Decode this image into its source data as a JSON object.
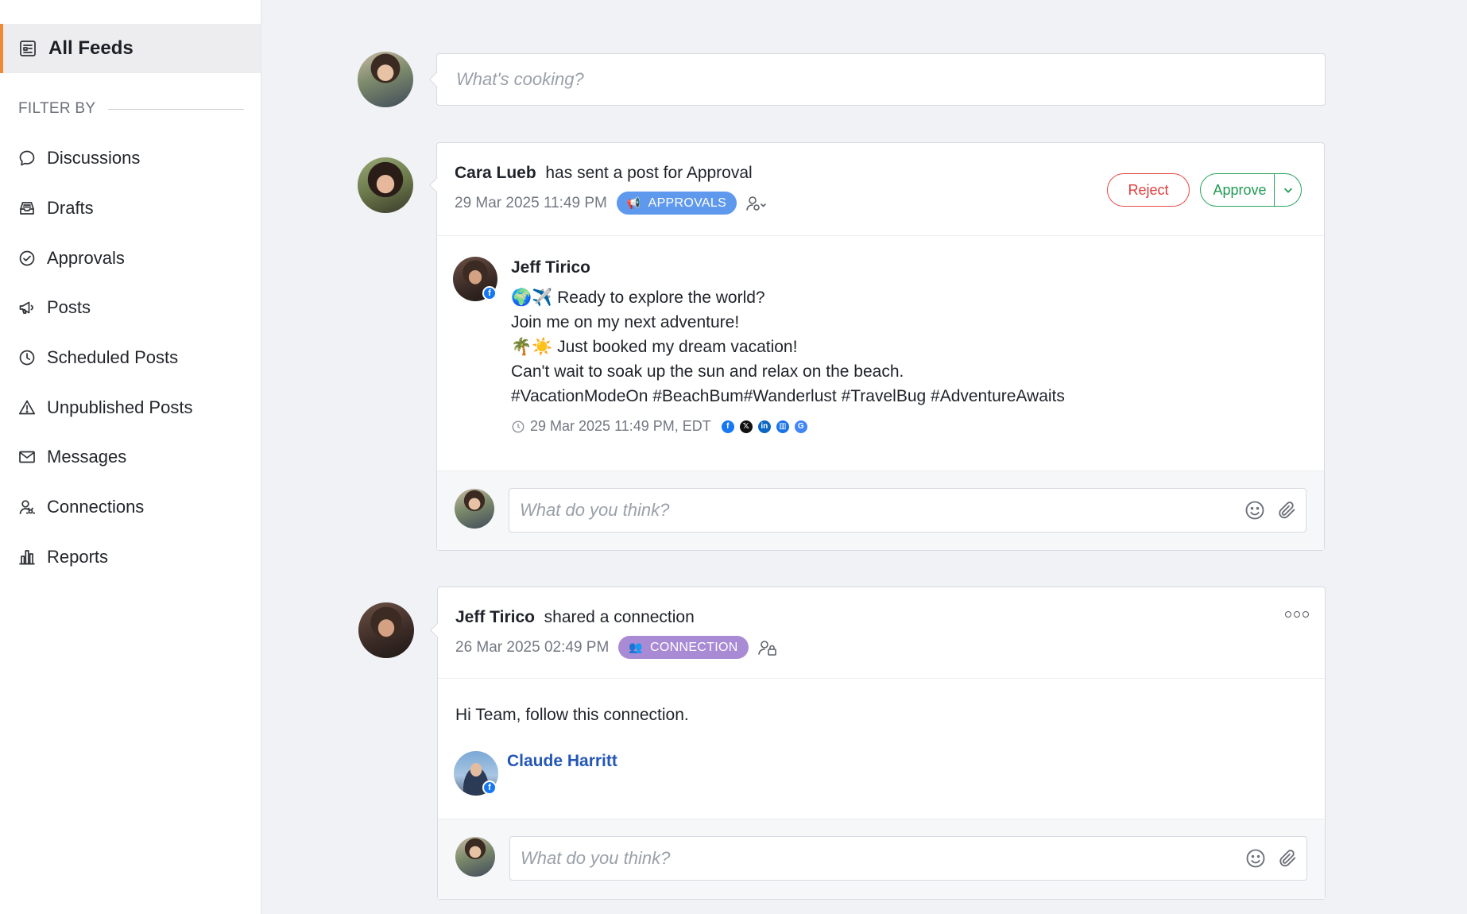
{
  "sidebar": {
    "all_feeds": "All Feeds",
    "filter_by": "FILTER BY",
    "items": [
      {
        "label": "Discussions",
        "icon": "chat-bubble-icon"
      },
      {
        "label": "Drafts",
        "icon": "inbox-tray-icon"
      },
      {
        "label": "Approvals",
        "icon": "check-circle-icon"
      },
      {
        "label": "Posts",
        "icon": "megaphone-icon"
      },
      {
        "label": "Scheduled Posts",
        "icon": "clock-icon"
      },
      {
        "label": "Unpublished Posts",
        "icon": "warning-triangle-icon"
      },
      {
        "label": "Messages",
        "icon": "envelope-icon"
      },
      {
        "label": "Connections",
        "icon": "user-connection-icon"
      },
      {
        "label": "Reports",
        "icon": "bar-chart-icon"
      }
    ],
    "accent_color": "#f08a34"
  },
  "composer": {
    "placeholder": "What's cooking?"
  },
  "approval_card": {
    "sender": "Cara Lueb",
    "action": "has sent a post for Approval",
    "timestamp": "29 Mar 2025 11:49 PM",
    "tag": "APPROVALS",
    "reject_label": "Reject",
    "approve_label": "Approve",
    "post": {
      "author": "Jeff Tirico",
      "lines": [
        "🌍✈️ Ready to explore the world?",
        "Join me on my next adventure!",
        "🌴☀️ Just booked my dream vacation!",
        "Can't wait to soak up the sun and relax on the beach.",
        "#VacationModeOn #BeachBum#Wanderlust #TravelBug #AdventureAwaits"
      ],
      "schedule": "29 Mar 2025 11:49 PM, EDT",
      "networks": [
        "facebook",
        "x",
        "linkedin",
        "google-business",
        "google"
      ]
    },
    "comment_placeholder": "What do you think?"
  },
  "connection_card": {
    "sender": "Jeff Tirico",
    "action": "shared a connection",
    "timestamp": "26 Mar 2025 02:49 PM",
    "tag": "CONNECTION",
    "message": "Hi Team, follow this connection.",
    "connection_name": "Claude Harritt",
    "comment_placeholder": "What do you think?"
  },
  "colors": {
    "approvals_tag": "#5f99ee",
    "connection_tag": "#a98ad5",
    "reject": "#e54848",
    "approve": "#2aa45e",
    "link": "#2356b5"
  }
}
